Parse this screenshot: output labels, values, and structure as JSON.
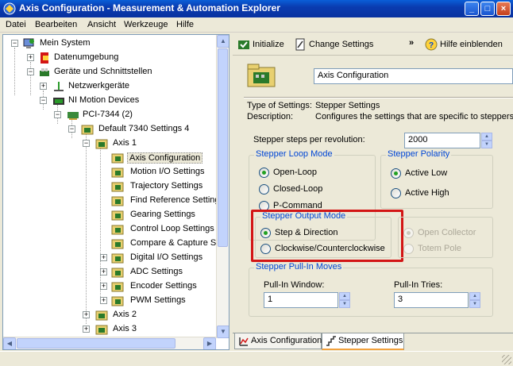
{
  "window": {
    "title": "Axis Configuration - Measurement & Automation Explorer"
  },
  "menu": [
    "Datei",
    "Bearbeiten",
    "Ansicht",
    "Werkzeuge",
    "Hilfe"
  ],
  "tree": [
    {
      "label": "Mein System"
    },
    {
      "label": "Datenumgebung"
    },
    {
      "label": "Geräte und Schnittstellen"
    },
    {
      "label": "Netzwerkgeräte"
    },
    {
      "label": "NI Motion Devices"
    },
    {
      "label": "PCI-7344 (2)"
    },
    {
      "label": "Default 7340 Settings 4"
    },
    {
      "label": "Axis 1"
    },
    {
      "label": "Axis Configuration"
    },
    {
      "label": "Motion I/O Settings"
    },
    {
      "label": "Trajectory Settings"
    },
    {
      "label": "Find Reference Setting"
    },
    {
      "label": "Gearing Settings"
    },
    {
      "label": "Control Loop Settings"
    },
    {
      "label": "Compare & Capture Se"
    },
    {
      "label": "Digital I/O Settings"
    },
    {
      "label": "ADC Settings"
    },
    {
      "label": "Encoder Settings"
    },
    {
      "label": "PWM Settings"
    },
    {
      "label": "Axis 2"
    },
    {
      "label": "Axis 3"
    }
  ],
  "toolbar": {
    "initialize": "Initialize",
    "change_settings": "Change Settings",
    "more": "»",
    "help": "Hilfe einblenden"
  },
  "config": {
    "name": "Axis Configuration",
    "type_label": "Type of Settings:",
    "type_value": "Stepper Settings",
    "desc_label": "Description:",
    "desc_value": "Configures the settings that are specific to steppers",
    "steps_label": "Stepper steps per revolution:",
    "steps_value": "2000",
    "loop_mode": {
      "title": "Stepper Loop Mode",
      "options": [
        "Open-Loop",
        "Closed-Loop",
        "P-Command"
      ],
      "selected": 0
    },
    "polarity": {
      "title": "Stepper Polarity",
      "options": [
        "Active Low",
        "Active High"
      ],
      "selected": 0
    },
    "output_mode": {
      "title": "Stepper Output Mode",
      "options": [
        "Step & Direction",
        "Clockwise/Counterclockwise"
      ],
      "selected": 0
    },
    "output_drive": {
      "options": [
        "Open Collector",
        "Totem Pole"
      ],
      "selected": 0
    },
    "pullin": {
      "title": "Stepper Pull-In Moves",
      "window_label": "Pull-In Window:",
      "window_value": "1",
      "tries_label": "Pull-In Tries:",
      "tries_value": "3"
    }
  },
  "tabs": [
    "Axis Configuration",
    "Stepper Settings"
  ],
  "colors": {
    "highlight": "#d31515",
    "group_title": "#0046d5",
    "title_bar": "#0a3cb0"
  }
}
